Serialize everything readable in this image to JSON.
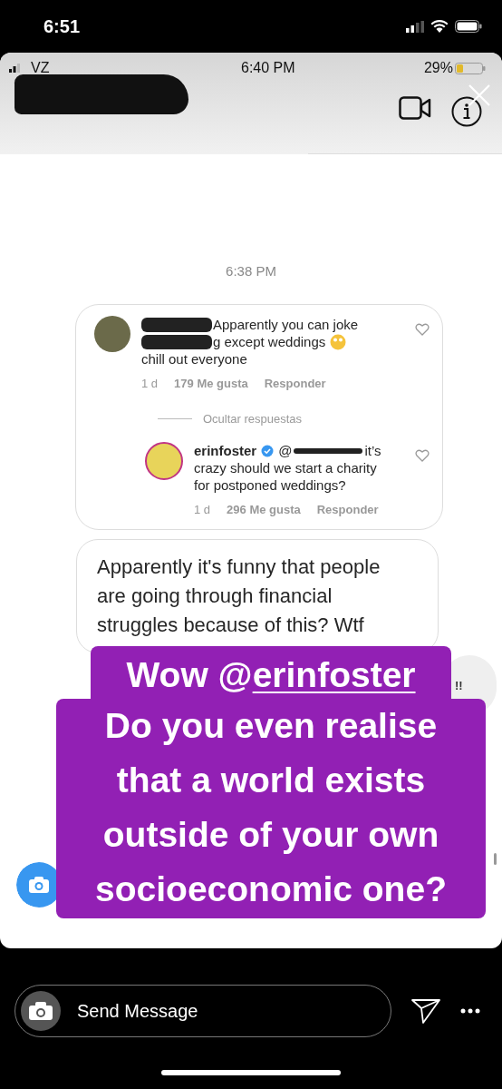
{
  "status_bar": {
    "time": "6:51"
  },
  "story": {
    "inner_status": {
      "carrier": "VZ",
      "time": "6:40 PM",
      "battery": "29%"
    },
    "timestamp": "6:38 PM",
    "comment": {
      "lines": [
        {
          "text": "Apparently you can joke",
          "redacted": true,
          "emoji": false
        },
        {
          "text": "g except weddings",
          "redacted": true,
          "emoji": true
        },
        {
          "text": "chill out everyone",
          "redacted": false,
          "emoji": false
        }
      ],
      "age": "1 d",
      "likes": "179 Me gusta",
      "reply": "Responder"
    },
    "hide_replies": "Ocultar respuestas",
    "reply": {
      "username": "erinfoster",
      "verified": true,
      "mention": "@",
      "first_words": "it’s",
      "lines": [
        "crazy should we start a charity",
        "for postponed weddings?"
      ],
      "age": "1 d",
      "likes": "296 Me gusta",
      "reply": "Responder"
    },
    "message": "Apparently it's funny that people are going through financial struggles because of this? Wtf",
    "peek_text": "!!",
    "caption": {
      "prefix": "Wow @",
      "mention": "erinfoster",
      "lines": [
        "Do you even realise",
        "that a world exists",
        "outside of your own",
        "socioeconomic one?"
      ]
    }
  },
  "reply_bar": {
    "placeholder": "Send Message"
  }
}
